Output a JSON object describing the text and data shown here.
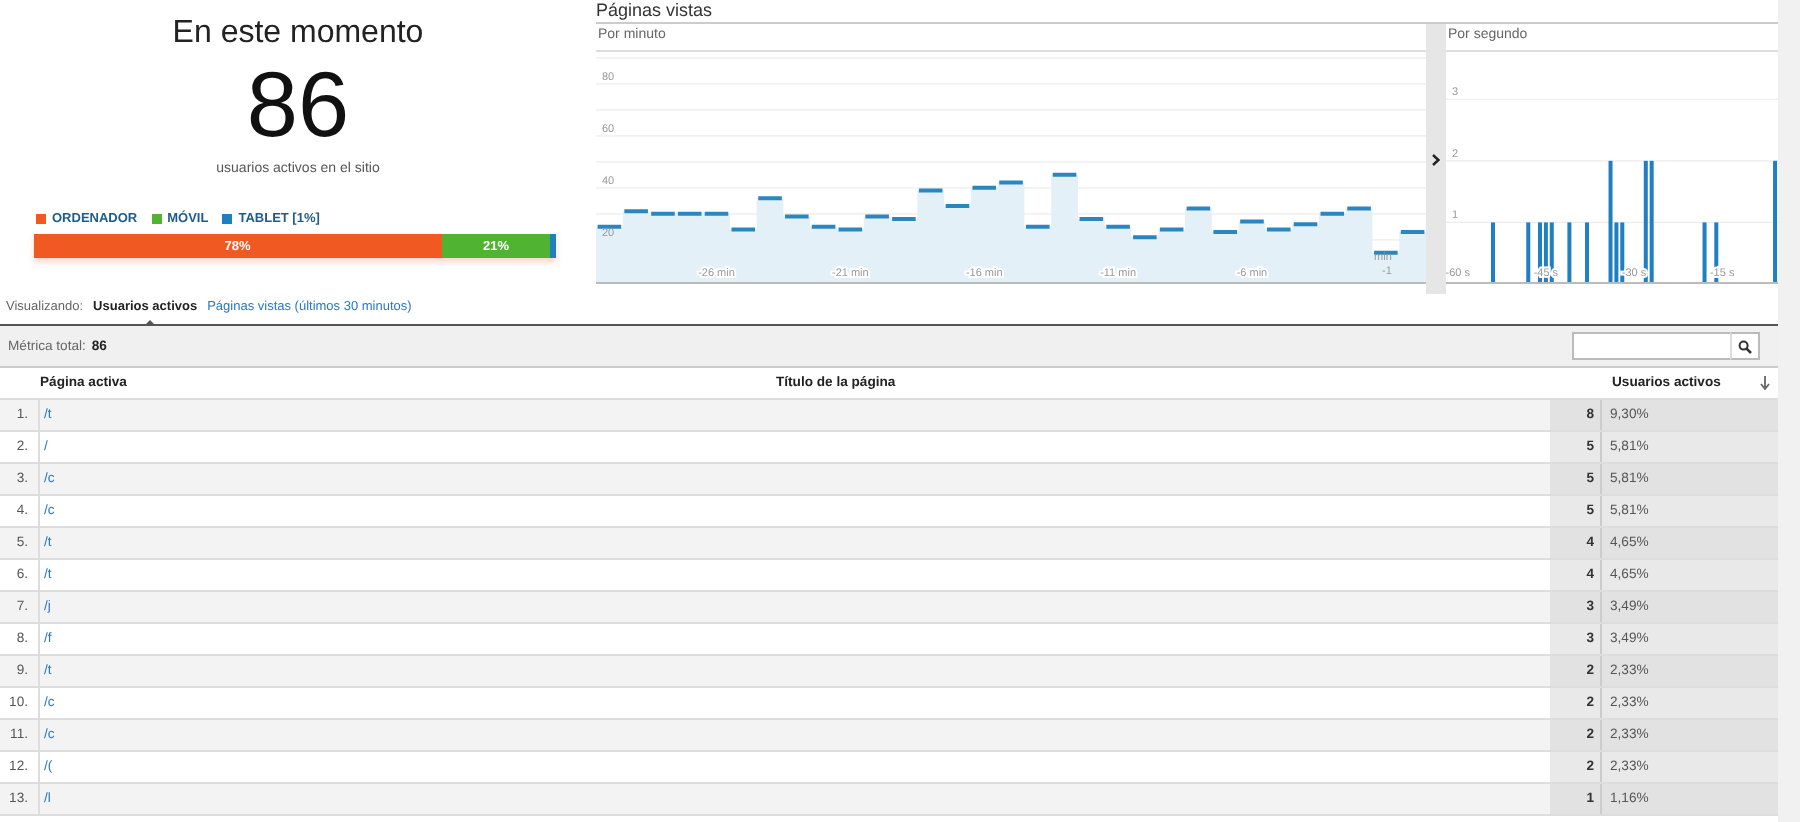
{
  "summary": {
    "title": "En este momento",
    "count": "86",
    "caption": "usuarios activos en el sitio",
    "devices": [
      {
        "name": "ORDENADOR",
        "color": "#f05a22",
        "level": 0.78,
        "bar_label": "78%"
      },
      {
        "name": "MÓVIL",
        "color": "#50b432",
        "level": 0.21,
        "bar_label": "21%"
      },
      {
        "name": "TABLET [1%]",
        "color": "#1f7fc0",
        "level": 0.01
      }
    ]
  },
  "pageviews": {
    "title": "Páginas vistas",
    "per_minute": {
      "label": "Por minuto",
      "chart_data": {
        "type": "area",
        "grid": true,
        "x": [
          -30.5,
          -29.5,
          -29.5,
          -28.5,
          -28.5,
          -27.5,
          -27.5,
          -26.5,
          -26.5,
          -25.5,
          -25.5,
          -24.5,
          -24.5,
          -23.5,
          -23.5,
          -22.5,
          -22.5,
          -21.5,
          -21.5,
          -20.5,
          -20.5,
          -19.5,
          -19.5,
          -18.5,
          -18.5,
          -17.5,
          -17.5,
          -16.5,
          -16.5,
          -15.5,
          -15.5,
          -14.5,
          -14.5,
          -13.5,
          -13.5,
          -12.5,
          -12.5,
          -11.5,
          -11.5,
          -10.5,
          -10.5,
          -9.5,
          -9.5,
          -8.5,
          -8.5,
          -7.5,
          -7.5,
          -6.5,
          -6.5,
          -5.5,
          -5.5,
          -4.5,
          -4.5,
          -3.5,
          -3.5,
          -2.5,
          -2.5,
          -1.5,
          -1.5,
          -0.5,
          -0.5,
          0.5
        ],
        "values": [
          25,
          25,
          31,
          31,
          30,
          30,
          30,
          30,
          30,
          30,
          24,
          24,
          36,
          36,
          29,
          29,
          25,
          25,
          24,
          24,
          29,
          29,
          28,
          28,
          39,
          39,
          33,
          33,
          40,
          40,
          42,
          42,
          25,
          25,
          45,
          45,
          28,
          28,
          25,
          25,
          21,
          21,
          24,
          24,
          32,
          32,
          23,
          23,
          27,
          27,
          24,
          24,
          26,
          26,
          30,
          30,
          32,
          32,
          15,
          15,
          23,
          23
        ],
        "xlim": [
          -30.5,
          0.5
        ],
        "ylim": [
          3,
          93
        ],
        "yticks": [
          20,
          40,
          60,
          80
        ],
        "xticks": [
          {
            "value": -26,
            "label": "-26 min"
          },
          {
            "value": -21,
            "label": "-21 min"
          },
          {
            "value": -16,
            "label": "-16 min"
          },
          {
            "value": -11,
            "label": "-11 min"
          },
          {
            "value": -6,
            "label": "-6 min"
          },
          {
            "value": -1,
            "label": "min -1"
          }
        ]
      }
    },
    "per_second": {
      "label": "Por segundo",
      "chart_data": {
        "type": "bar",
        "grid": true,
        "x": [
          -54,
          -48,
          -46,
          -45,
          -44,
          -41,
          -38,
          -34,
          -33,
          -32,
          -28,
          -27,
          -18,
          -16,
          -6
        ],
        "values": [
          1,
          1,
          1,
          1,
          1,
          1,
          1,
          2,
          1,
          1,
          2,
          2,
          1,
          1,
          2
        ],
        "xlim": [
          -62,
          -5.5
        ],
        "ylim": [
          0,
          3.8
        ],
        "yticks": [
          1,
          2,
          3
        ],
        "xticks": [
          {
            "value": -60,
            "label": "-60 s"
          },
          {
            "value": -45,
            "label": "-45 s"
          },
          {
            "value": -30,
            "label": "-30 s"
          },
          {
            "value": -15,
            "label": "-15 s"
          }
        ]
      }
    }
  },
  "view_toggle": {
    "label": "Visualizando:",
    "options": [
      {
        "label": "Usuarios activos",
        "selected": true
      },
      {
        "label": "Páginas vistas (últimos 30 minutos)",
        "selected": false
      }
    ]
  },
  "table": {
    "total_label": "Métrica total:",
    "total": "86",
    "columns": [
      "Página activa",
      "Título de la página",
      "Usuarios activos"
    ],
    "rows": [
      {
        "index": "1.",
        "page": "/t",
        "count": "8",
        "percent": "9,30%"
      },
      {
        "index": "2.",
        "page": "/",
        "count": "5",
        "percent": "5,81%"
      },
      {
        "index": "3.",
        "page": "/c",
        "count": "5",
        "percent": "5,81%"
      },
      {
        "index": "4.",
        "page": "/c",
        "count": "5",
        "percent": "5,81%"
      },
      {
        "index": "5.",
        "page": "/t",
        "count": "4",
        "percent": "4,65%"
      },
      {
        "index": "6.",
        "page": "/t",
        "count": "4",
        "percent": "4,65%"
      },
      {
        "index": "7.",
        "page": "/j",
        "count": "3",
        "percent": "3,49%"
      },
      {
        "index": "8.",
        "page": "/f",
        "count": "3",
        "percent": "3,49%"
      },
      {
        "index": "9.",
        "page": "/t",
        "count": "2",
        "percent": "2,33%"
      },
      {
        "index": "10.",
        "page": "/c",
        "count": "2",
        "percent": "2,33%"
      },
      {
        "index": "11.",
        "page": "/c",
        "count": "2",
        "percent": "2,33%"
      },
      {
        "index": "12.",
        "page": "/(",
        "count": "2",
        "percent": "2,33%"
      },
      {
        "index": "13.",
        "page": "/l",
        "count": "1",
        "percent": "1,16%"
      }
    ]
  }
}
